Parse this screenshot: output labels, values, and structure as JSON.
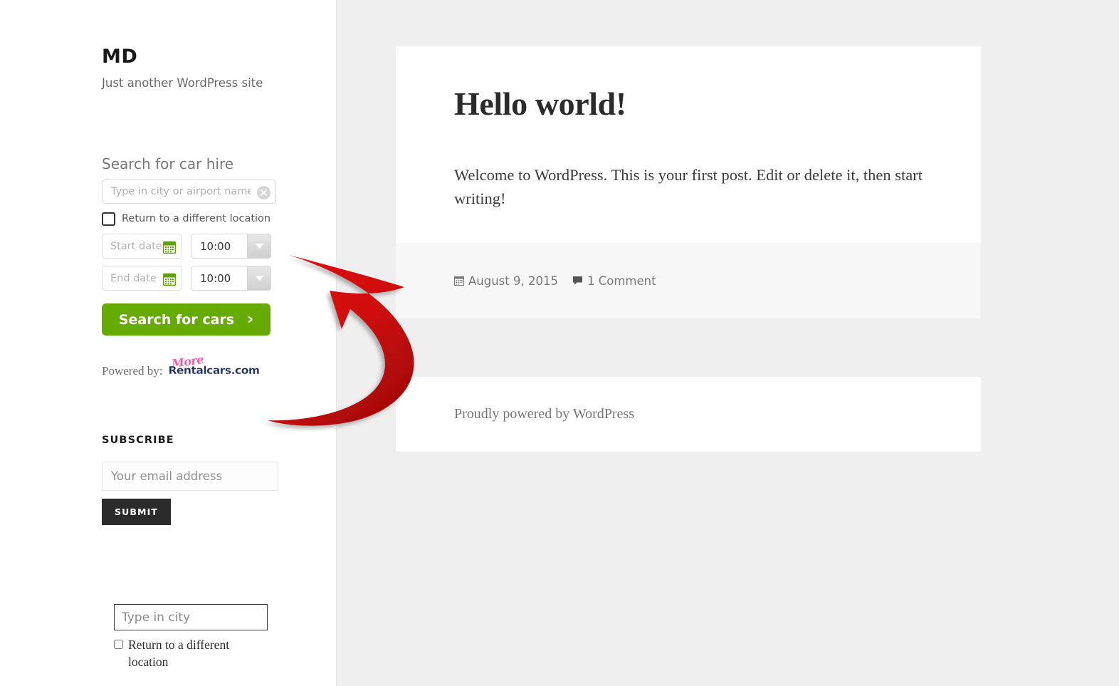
{
  "sidebar": {
    "site_title": "MD",
    "site_description": "Just another WordPress site",
    "car_hire": {
      "heading": "Search for car hire",
      "location_placeholder": "Type in city or airport name",
      "location_value": "",
      "clear_icon": "clear-circle-x-icon",
      "return_different_location_label": "Return to a different location",
      "start_date_placeholder": "Start date",
      "start_date_value": "",
      "end_date_placeholder": "End date",
      "end_date_value": "",
      "calendar_icon": "calendar-icon",
      "start_time_value": "10:00",
      "end_time_value": "10:00",
      "dropdown_icon": "chevron-down-icon",
      "submit_label": "Search for cars",
      "submit_chevron": "›",
      "powered_by_label": "Powered by:",
      "logo_more": "More",
      "logo_name": "Rentalcars.com",
      "accent_green": "#66ab02"
    },
    "subscribe": {
      "heading": "SUBSCRIBE",
      "email_placeholder": "Your email address",
      "email_value": "",
      "submit_label": "SUBMIT"
    },
    "city_widget": {
      "city_placeholder": "Type in city",
      "city_value": "",
      "return_different_location_label": "Return to a different location"
    }
  },
  "main": {
    "post": {
      "title": "Hello world!",
      "body": "Welcome to WordPress. This is your first post. Edit or delete it, then start writing!",
      "meta": {
        "date_icon": "calendar-icon",
        "date": "August 9, 2015",
        "comment_icon": "comment-bubble-icon",
        "comments": "1 Comment"
      }
    },
    "footer": {
      "credit": "Proudly powered by WordPress"
    }
  },
  "annotation": {
    "arrow_icon": "curved-arrow-icon",
    "arrow_color": "#cf0a0a"
  }
}
